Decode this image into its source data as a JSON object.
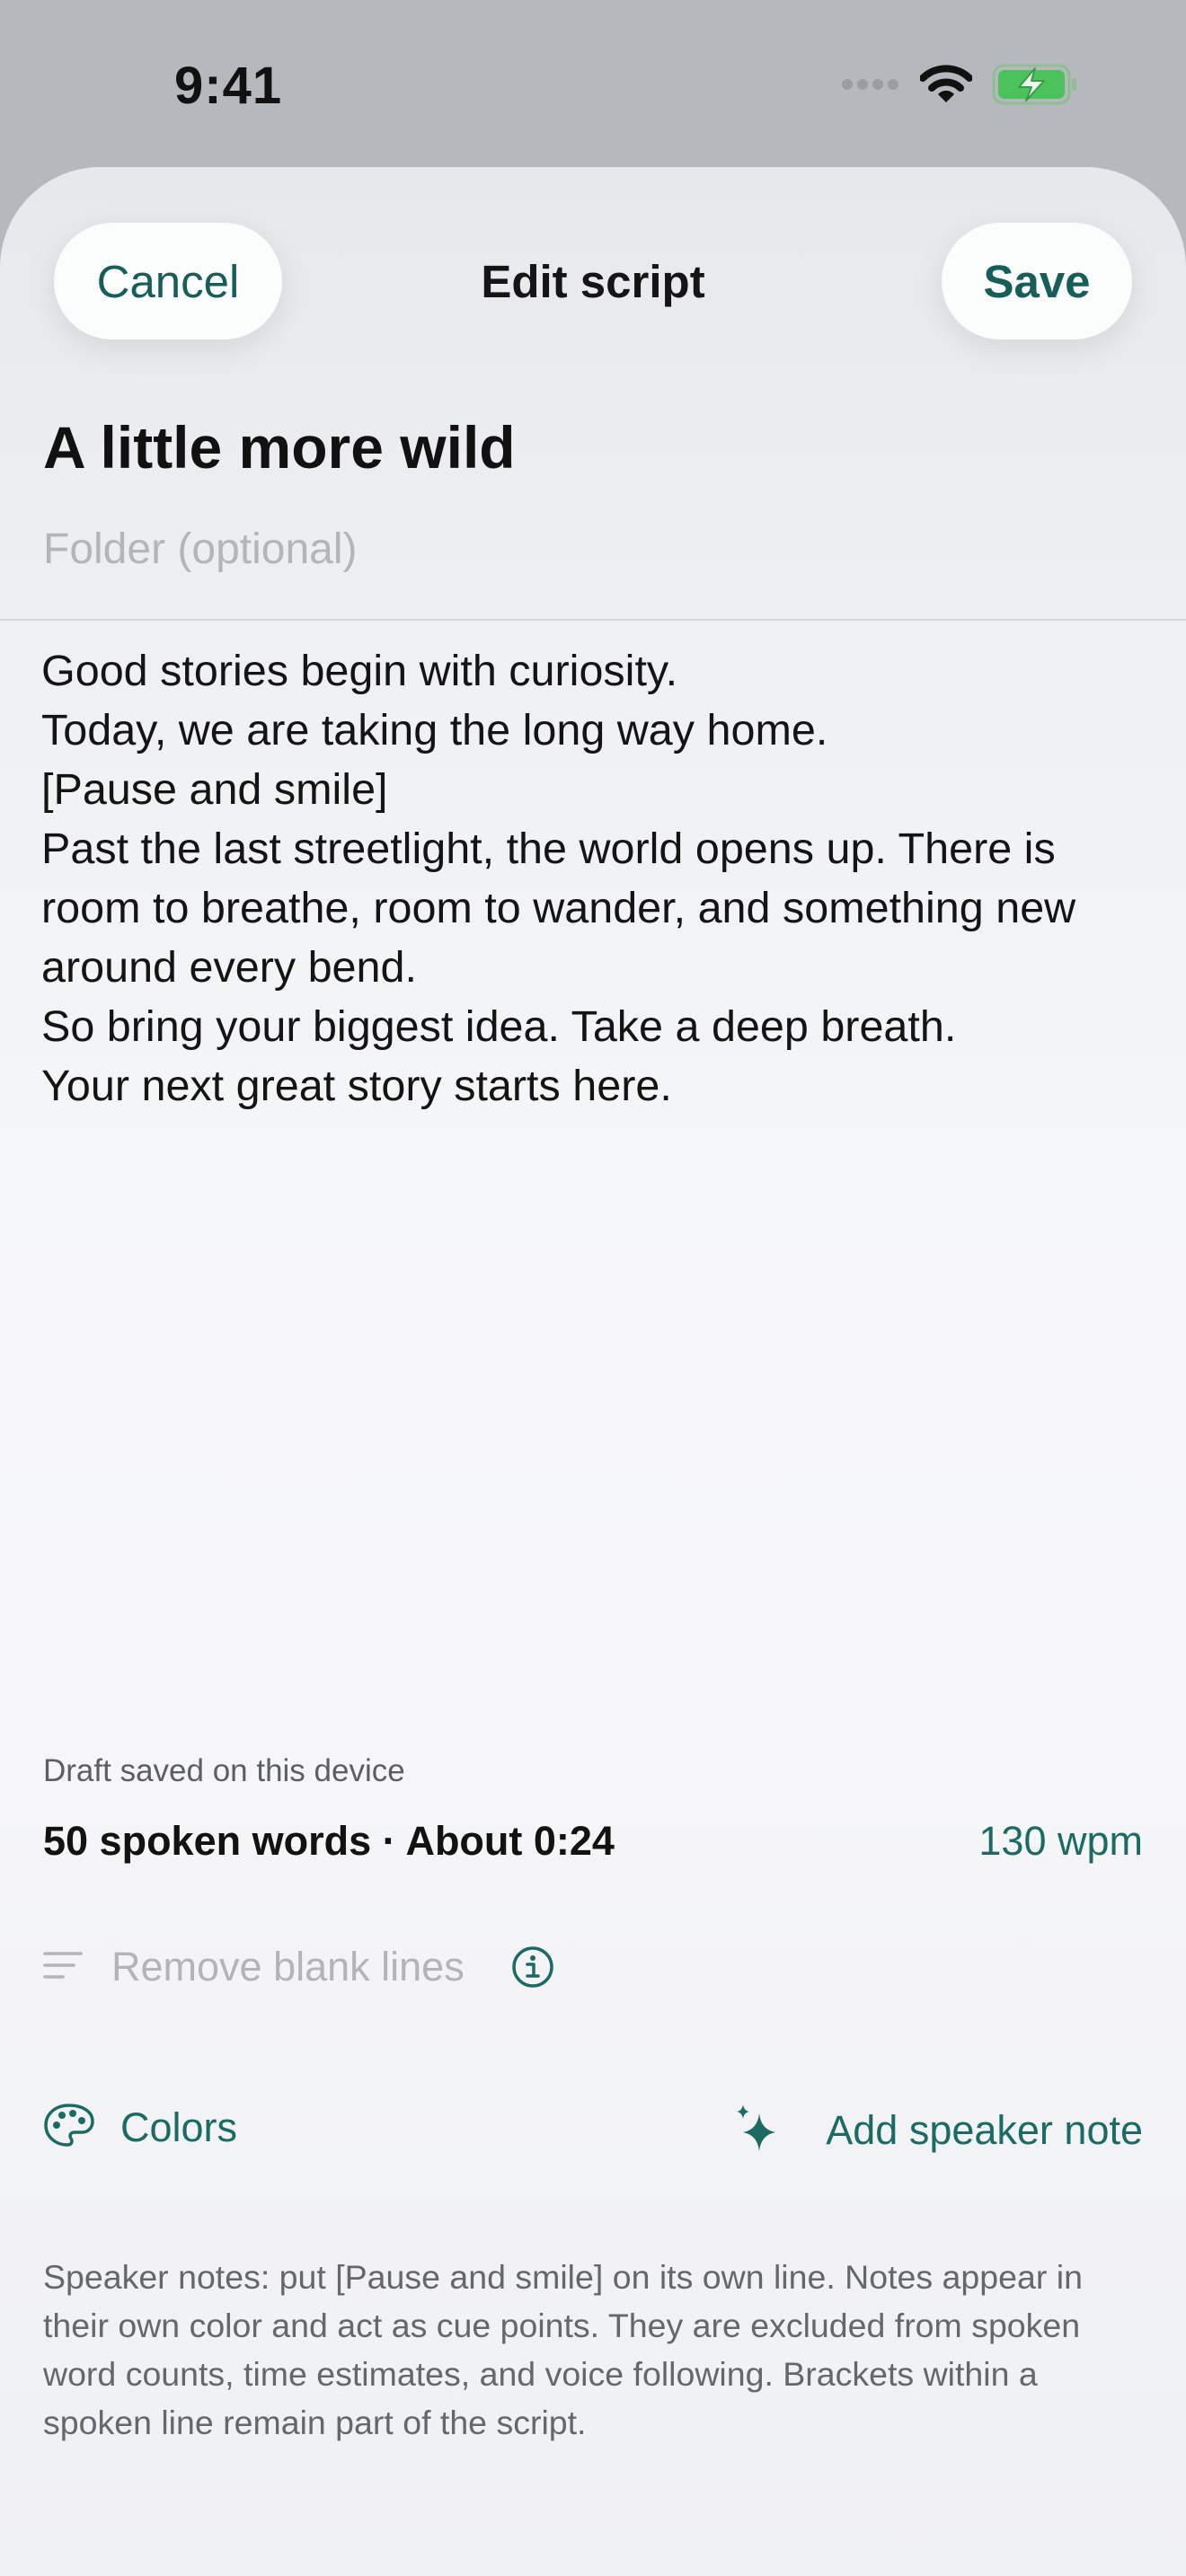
{
  "status_bar": {
    "time": "9:41"
  },
  "header": {
    "cancel_label": "Cancel",
    "title": "Edit script",
    "save_label": "Save"
  },
  "script": {
    "title": "A little more wild",
    "folder_placeholder": "Folder (optional)",
    "lines": [
      "Good stories begin with curiosity.",
      "Today, we are taking the long way home.",
      "[Pause and smile]",
      "Past the last streetlight, the world opens up. There is",
      "room to breathe, room to wander, and something new",
      "around every bend.",
      "So bring your biggest idea. Take a deep breath.",
      "Your next great story starts here."
    ]
  },
  "footer": {
    "draft_status": "Draft saved on this device",
    "word_stats": "50 spoken words · About 0:24",
    "wpm": "130 wpm",
    "remove_blank_lines": "Remove blank lines",
    "colors_label": "Colors",
    "add_speaker_note_label": "Add speaker note",
    "help_text": "Speaker notes: put [Pause and smile] on its own line. Notes appear in their own color and act as cue points. They are excluded from spoken word counts, time estimates, and voice following. Brackets within a spoken line remain part of the script."
  },
  "icons": {
    "signal": "cellular-signal-icon",
    "wifi": "wifi-icon",
    "battery": "battery-charging-icon",
    "lines": "text-lines-icon",
    "info": "info-icon",
    "palette": "palette-icon",
    "sparkle": "sparkle-icon"
  },
  "colors": {
    "accent": "#1b6a64",
    "battery": "#4cc25a",
    "disabled_text": "#b2b4b7"
  }
}
